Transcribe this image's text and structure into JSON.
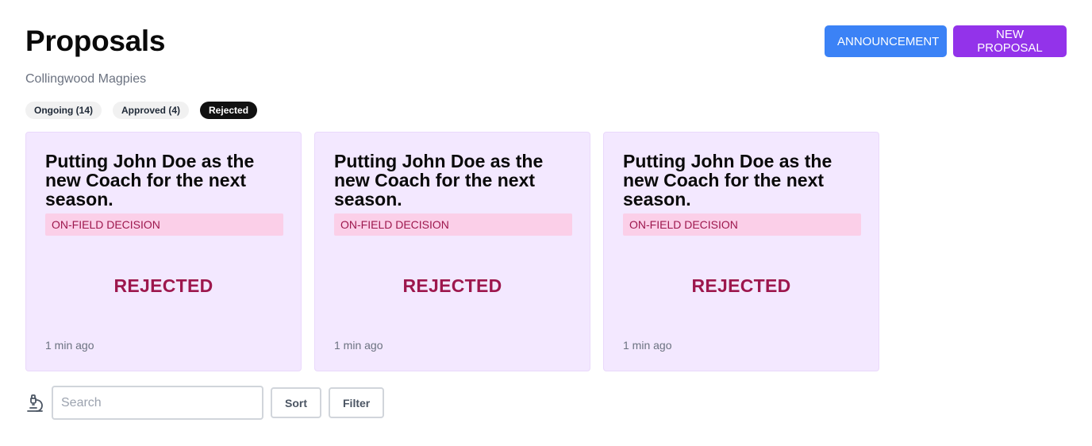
{
  "header": {
    "title": "Proposals",
    "subtitle": "Collingwood Magpies",
    "announcement_label": "ANNOUNCEMENT",
    "new_proposal_label": "NEW PROPOSAL"
  },
  "tabs": [
    {
      "label": "Ongoing (14)",
      "active": false
    },
    {
      "label": "Approved (4)",
      "active": false
    },
    {
      "label": "Rejected",
      "active": true
    }
  ],
  "cards": [
    {
      "title": "Putting John Doe as the new Coach for the next season.",
      "tag": "ON-FIELD DECISION",
      "status": "REJECTED",
      "time": "1 min ago"
    },
    {
      "title": "Putting John Doe as the new Coach for the next season.",
      "tag": "ON-FIELD DECISION",
      "status": "REJECTED",
      "time": "1 min ago"
    },
    {
      "title": "Putting John Doe as the new Coach for the next season.",
      "tag": "ON-FIELD DECISION",
      "status": "REJECTED",
      "time": "1 min ago"
    }
  ],
  "toolbar": {
    "icon": "microscope-icon",
    "search_placeholder": "Search",
    "search_value": "",
    "sort_label": "Sort",
    "filter_label": "Filter"
  },
  "colors": {
    "announcement": "#3b82f6",
    "new_proposal": "#9333ea",
    "card_bg": "#f3e8ff",
    "tag_bg": "#fbcfe8",
    "rejected": "#9d174d"
  }
}
